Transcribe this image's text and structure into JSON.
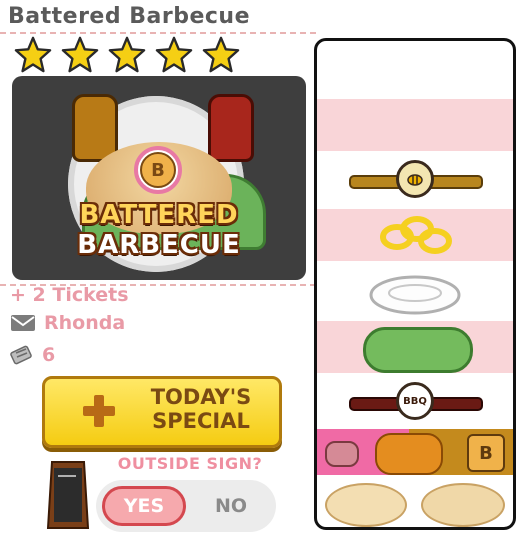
{
  "order": {
    "title": "Battered Barbecue",
    "star_count": 5,
    "star_color": "#f5cf14",
    "logo_line1": "BATTERED",
    "logo_line2": "BARBECUE",
    "badge_letter": "B"
  },
  "info": {
    "tickets": "+ 2 Tickets",
    "customer": "Rhonda",
    "ticket_count": "6"
  },
  "special_button": {
    "line1": "TODAY'S",
    "line2": "SPECIAL"
  },
  "outside_sign": {
    "label": "OUTSIDE SIGN?",
    "yes": "YES",
    "no": "NO",
    "selected": "YES"
  },
  "stack": {
    "sauce_top_label": "",
    "sauce_bottom_label": "BBQ",
    "badge_letter": "B",
    "items": [
      "empty",
      "empty",
      "honey-mustard",
      "onion-rings",
      "plate",
      "lettuce",
      "bbq-sauce",
      "patty-row",
      "buns"
    ]
  },
  "colors": {
    "accent_pink": "#e99aa6",
    "button_yellow": "#f5cc12",
    "stack_pink": "#f9d5d8"
  }
}
